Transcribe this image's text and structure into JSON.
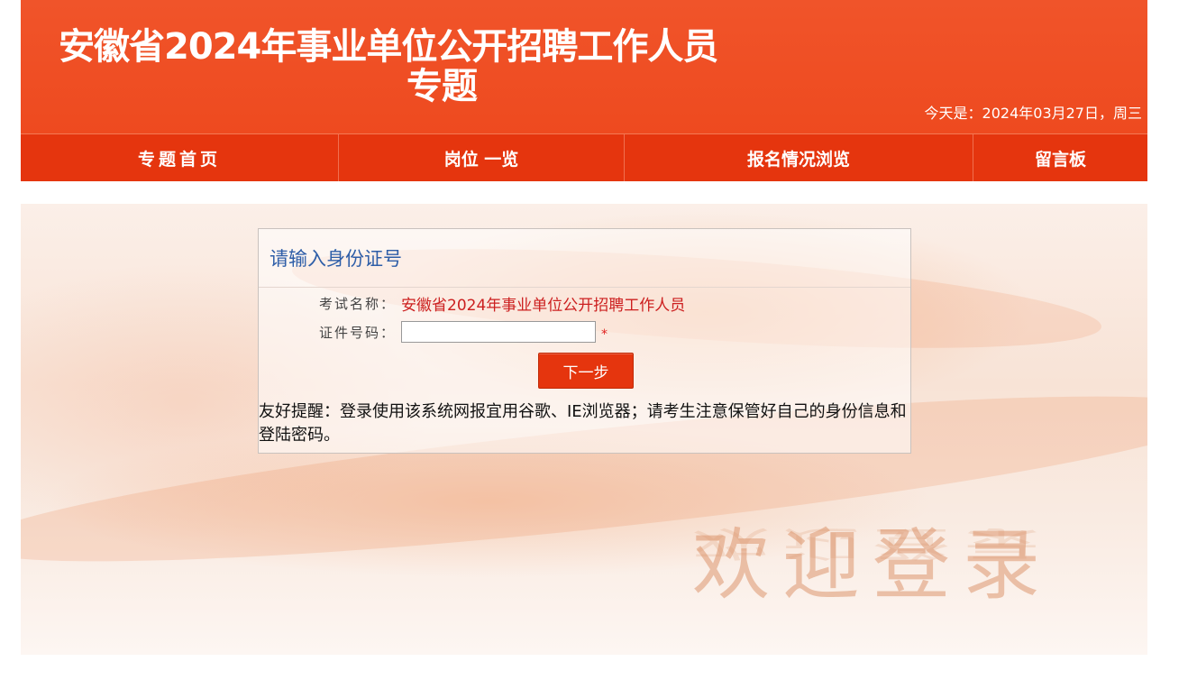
{
  "banner": {
    "title_line1": "安徽省2024年事业单位公开招聘工作人员",
    "title_line2": "专题",
    "today": "今天是：2024年03月27日，周三"
  },
  "nav": {
    "items": [
      {
        "label": "专题首页"
      },
      {
        "label": "岗位 一览"
      },
      {
        "label": "报名情况浏览"
      },
      {
        "label": "留言板"
      }
    ]
  },
  "login": {
    "heading": "请输入身份证号",
    "exam_label": "考试名称：",
    "exam_name": "安徽省2024年事业单位公开招聘工作人员",
    "id_label": "证件号码：",
    "id_value": "",
    "required_mark": "*",
    "next_button": "下一步",
    "tip": "友好提醒：登录使用该系统网报宜用谷歌、IE浏览器；请考生注意保管好自己的身份信息和登陆密码。"
  },
  "background": {
    "welcome_text": "欢迎登录"
  },
  "colors": {
    "brand_red": "#e5350e",
    "banner_orange": "#ee4a1f",
    "heading_blue": "#2e5ea8",
    "exam_name_red": "#cc1f1f"
  }
}
